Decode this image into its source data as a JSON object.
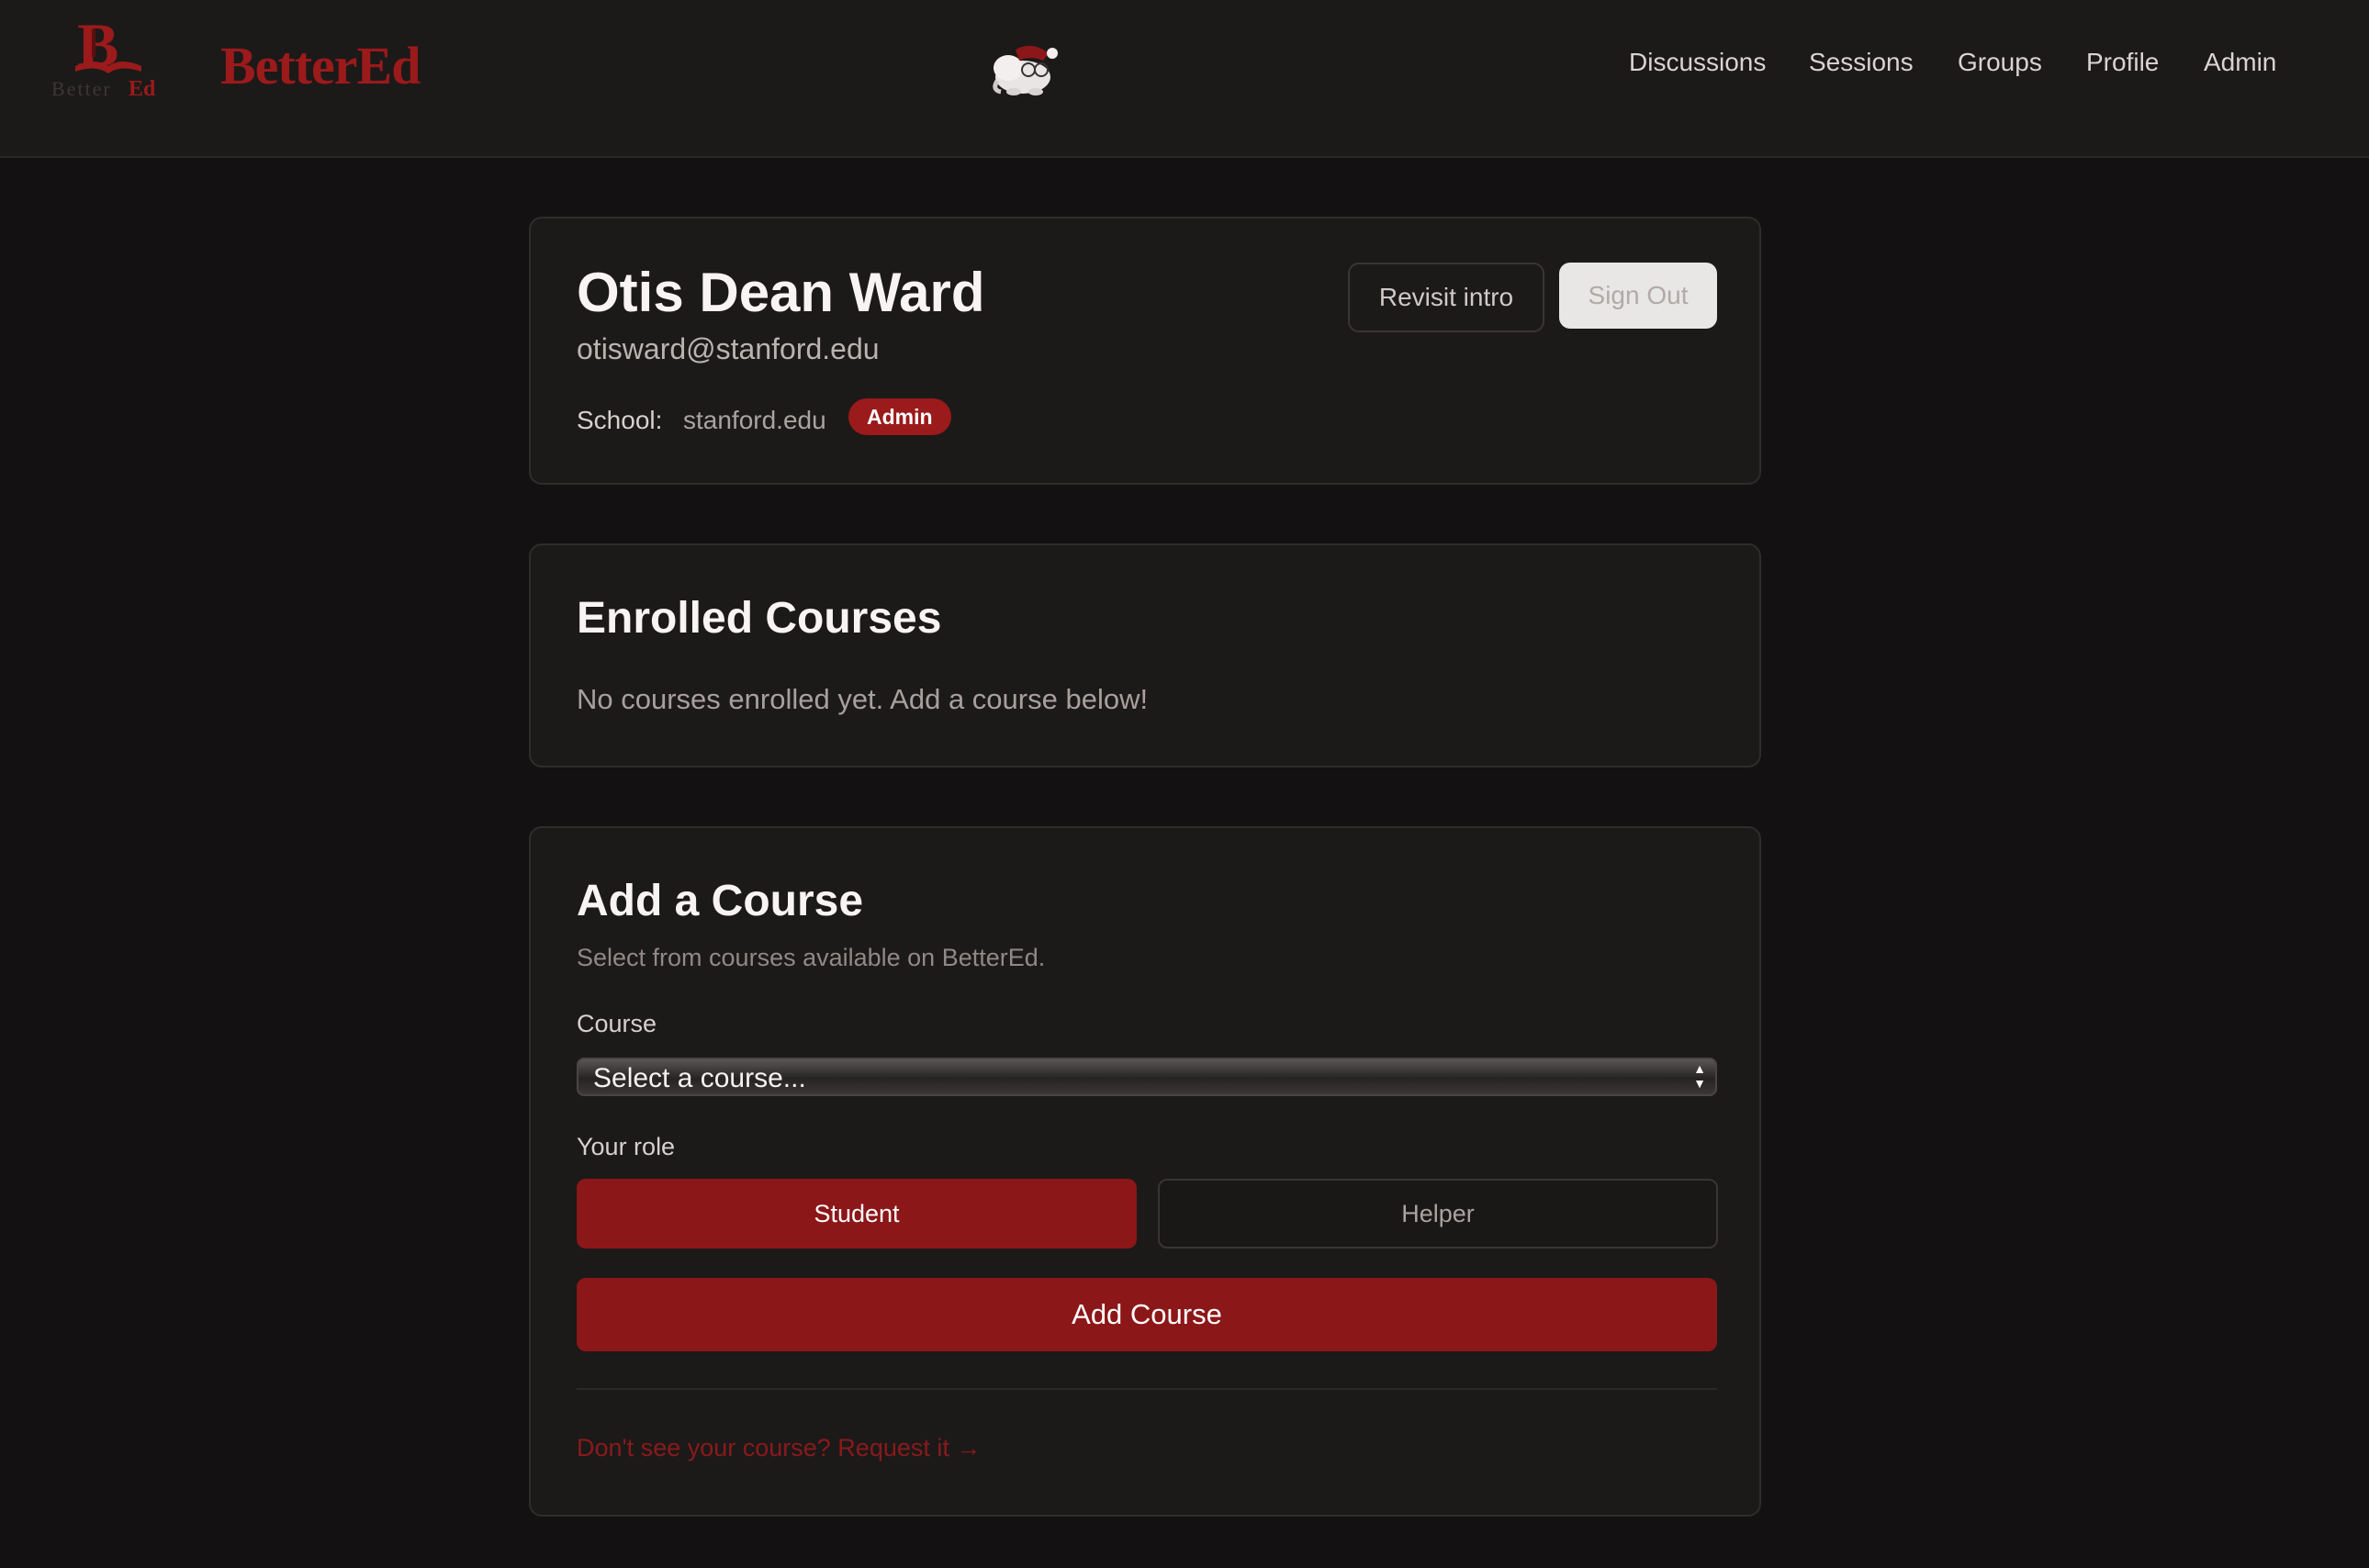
{
  "header": {
    "logo_small_text": "BetterEd",
    "brand": "BetterEd",
    "nav": [
      "Discussions",
      "Sessions",
      "Groups",
      "Profile",
      "Admin"
    ]
  },
  "profile": {
    "name": "Otis Dean Ward",
    "email": "otisward@stanford.edu",
    "school_label": "School:",
    "school_value": "stanford.edu",
    "role_badge": "Admin",
    "revisit_label": "Revisit intro",
    "signout_label": "Sign Out"
  },
  "enrolled": {
    "title": "Enrolled Courses",
    "empty_text": "No courses enrolled yet. Add a course below!"
  },
  "add_course": {
    "title": "Add a Course",
    "subtitle": "Select from courses available on BetterEd.",
    "course_label": "Course",
    "course_selected": "Select a course...",
    "role_label": "Your role",
    "role_student": "Student",
    "role_helper": "Helper",
    "submit_label": "Add Course",
    "request_link": "Don't see your course? Request it →"
  },
  "colors": {
    "accent": "#8c1718",
    "background": "#131111",
    "card": "#1c1919"
  },
  "icons": {
    "logo": "betterEd-logo-icon",
    "mascot": "elephant-mascot-icon",
    "select_arrows": "select-arrows-icon"
  }
}
